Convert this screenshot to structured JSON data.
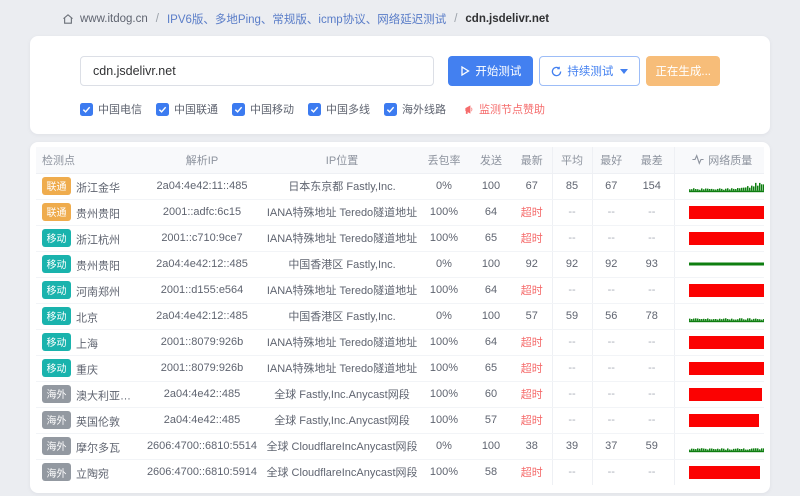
{
  "breadcrumb": {
    "home": "www.itdog.cn",
    "section": "IPV6版、多地Ping、常规版、icmp协议、网络延迟测试",
    "current": "cdn.jsdelivr.net"
  },
  "test_panel": {
    "input_value": "cdn.jsdelivr.net",
    "start_button": "开始测试",
    "continuous_button": "持续测试",
    "generating_button": "正在生成...",
    "checkboxes": [
      {
        "label": "中国电信",
        "checked": true
      },
      {
        "label": "中国联通",
        "checked": true
      },
      {
        "label": "中国移动",
        "checked": true
      },
      {
        "label": "中国多线",
        "checked": true
      },
      {
        "label": "海外线路",
        "checked": true
      }
    ],
    "sponsor_link": "监测节点赞助"
  },
  "table": {
    "headers": [
      "检测点",
      "解析IP",
      "IP位置",
      "丢包率",
      "发送",
      "最新",
      "平均",
      "最好",
      "最差",
      "网络质量"
    ],
    "timeout_label": "超时",
    "empty_value": "--",
    "carrier_colors": {
      "联通": "#efac4d",
      "移动": "#1ab3ad",
      "海外": "#9399a1"
    },
    "quality_colors": {
      "good": "#0e7e10",
      "bad": "#fb0202"
    },
    "rows": [
      {
        "carrier": "联通",
        "location": "浙江金华",
        "ip": "2a04:4e42:11::485",
        "ip_location": "日本东京都 Fastly,Inc.",
        "loss": "0%",
        "sent": 100,
        "latest": "67",
        "avg": "85",
        "best": "67",
        "worst": "154",
        "quality": "spark-bump"
      },
      {
        "carrier": "联通",
        "location": "贵州贵阳",
        "ip": "2001::adfc:6c15",
        "ip_location": "IANA特殊地址 Teredo隧道地址",
        "loss": "100%",
        "sent": 64,
        "latest": "超时",
        "avg": "--",
        "best": "--",
        "worst": "--",
        "quality": "loss"
      },
      {
        "carrier": "移动",
        "location": "浙江杭州",
        "ip": "2001::c710:9ce7",
        "ip_location": "IANA特殊地址 Teredo隧道地址",
        "loss": "100%",
        "sent": 65,
        "latest": "超时",
        "avg": "--",
        "best": "--",
        "worst": "--",
        "quality": "loss"
      },
      {
        "carrier": "移动",
        "location": "贵州贵阳",
        "ip": "2a04:4e42:12::485",
        "ip_location": "中国香港区 Fastly,Inc.",
        "loss": "0%",
        "sent": 100,
        "latest": "92",
        "avg": "92",
        "best": "92",
        "worst": "93",
        "quality": "flat"
      },
      {
        "carrier": "移动",
        "location": "河南郑州",
        "ip": "2001::d155:e564",
        "ip_location": "IANA特殊地址 Teredo隧道地址",
        "loss": "100%",
        "sent": 64,
        "latest": "超时",
        "avg": "--",
        "best": "--",
        "worst": "--",
        "quality": "loss"
      },
      {
        "carrier": "移动",
        "location": "北京",
        "ip": "2a04:4e42:12::485",
        "ip_location": "中国香港区 Fastly,Inc.",
        "loss": "0%",
        "sent": 100,
        "latest": "57",
        "avg": "59",
        "best": "56",
        "worst": "78",
        "quality": "spark"
      },
      {
        "carrier": "移动",
        "location": "上海",
        "ip": "2001::8079:926b",
        "ip_location": "IANA特殊地址 Teredo隧道地址",
        "loss": "100%",
        "sent": 64,
        "latest": "超时",
        "avg": "--",
        "best": "--",
        "worst": "--",
        "quality": "loss"
      },
      {
        "carrier": "移动",
        "location": "重庆",
        "ip": "2001::8079:926b",
        "ip_location": "IANA特殊地址 Teredo隧道地址",
        "loss": "100%",
        "sent": 65,
        "latest": "超时",
        "avg": "--",
        "best": "--",
        "worst": "--",
        "quality": "loss"
      },
      {
        "carrier": "海外",
        "location": "澳大利亚悉尼",
        "ip": "2a04:4e42::485",
        "ip_location": "全球 Fastly,Inc.Anycast网段",
        "loss": "100%",
        "sent": 60,
        "latest": "超时",
        "avg": "--",
        "best": "--",
        "worst": "--",
        "quality": "loss"
      },
      {
        "carrier": "海外",
        "location": "英国伦敦",
        "ip": "2a04:4e42::485",
        "ip_location": "全球 Fastly,Inc.Anycast网段",
        "loss": "100%",
        "sent": 57,
        "latest": "超时",
        "avg": "--",
        "best": "--",
        "worst": "--",
        "quality": "loss"
      },
      {
        "carrier": "海外",
        "location": "摩尔多瓦",
        "ip": "2606:4700::6810:5514",
        "ip_location": "全球 CloudflareIncAnycast网段",
        "loss": "0%",
        "sent": 100,
        "latest": "38",
        "avg": "39",
        "best": "37",
        "worst": "59",
        "quality": "spark"
      },
      {
        "carrier": "海外",
        "location": "立陶宛",
        "ip": "2606:4700::6810:5914",
        "ip_location": "全球 CloudflareIncAnycast网段",
        "loss": "100%",
        "sent": 58,
        "latest": "超时",
        "avg": "--",
        "best": "--",
        "worst": "--",
        "quality": "loss"
      }
    ]
  }
}
